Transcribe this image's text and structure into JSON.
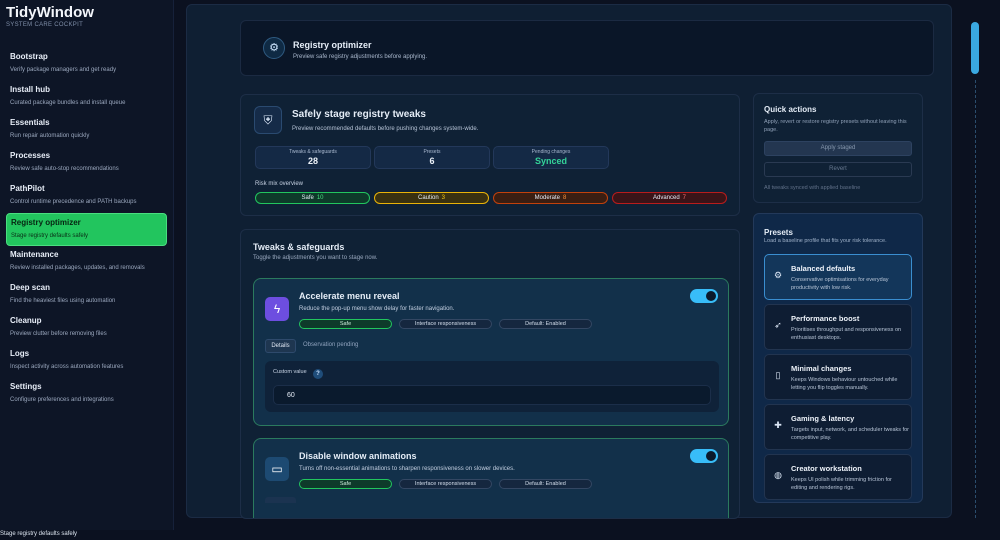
{
  "app": {
    "title": "TidyWindow",
    "subtitle": "SYSTEM CARE COCKPIT"
  },
  "sidebar": {
    "items": [
      {
        "label": "Bootstrap",
        "desc": "Verify package managers and get ready"
      },
      {
        "label": "Install hub",
        "desc": "Curated package bundles and install queue"
      },
      {
        "label": "Essentials",
        "desc": "Run repair automation quickly"
      },
      {
        "label": "Processes",
        "desc": "Review safe auto-stop recommendations"
      },
      {
        "label": "PathPilot",
        "desc": "Control runtime precedence and PATH backups"
      },
      {
        "label": "Registry optimizer",
        "desc": "Stage registry defaults safely",
        "active": true
      },
      {
        "label": "Maintenance",
        "desc": "Review installed packages, updates, and removals"
      },
      {
        "label": "Deep scan",
        "desc": "Find the heaviest files using automation"
      },
      {
        "label": "Cleanup",
        "desc": "Preview clutter before removing files"
      },
      {
        "label": "Logs",
        "desc": "Inspect activity across automation features"
      },
      {
        "label": "Settings",
        "desc": "Configure preferences and integrations"
      }
    ]
  },
  "header": {
    "title": "Registry optimizer",
    "subtitle": "Preview safe registry adjustments before applying.",
    "icon": "registry-icon"
  },
  "stage": {
    "title": "Safely stage registry tweaks",
    "subtitle": "Preview recommended defaults before pushing changes system-wide.",
    "stats": [
      {
        "label": "Tweaks & safeguards",
        "value": "28"
      },
      {
        "label": "Presets",
        "value": "6"
      },
      {
        "label": "Pending changes",
        "value": "Synced"
      }
    ],
    "risk_label": "Risk mix overview",
    "risk": [
      {
        "name": "Safe",
        "count": "10"
      },
      {
        "name": "Caution",
        "count": "3"
      },
      {
        "name": "Moderate",
        "count": "8"
      },
      {
        "name": "Advanced",
        "count": "7"
      }
    ]
  },
  "tweaks": {
    "title": "Tweaks & safeguards",
    "subtitle": "Toggle the adjustments you want to stage now.",
    "cards": [
      {
        "title": "Accelerate menu reveal",
        "desc": "Reduce the pop-up menu show delay for faster navigation.",
        "tags": [
          "Safe",
          "Interface responsiveness",
          "Default: Enabled"
        ],
        "details_label": "Details",
        "observation": "Observation pending",
        "custom_label": "Custom value",
        "custom_value": "60",
        "enabled": true
      },
      {
        "title": "Disable window animations",
        "desc": "Turns off non-essential animations to sharpen responsiveness on slower devices.",
        "tags": [
          "Safe",
          "Interface responsiveness",
          "Default: Enabled"
        ],
        "enabled": true
      }
    ]
  },
  "quick_actions": {
    "title": "Quick actions",
    "subtitle": "Apply, revert or restore registry presets without leaving this page.",
    "apply_label": "Apply staged",
    "revert_label": "Revert",
    "note": "All tweaks synced with applied baseline"
  },
  "presets": {
    "title": "Presets",
    "subtitle": "Load a baseline profile that fits your risk tolerance.",
    "items": [
      {
        "title": "Balanced defaults",
        "desc": "Conservative optimisations for everyday productivity with low risk.",
        "icon": "gear-icon",
        "selected": true
      },
      {
        "title": "Performance boost",
        "desc": "Prioritises throughput and responsiveness on enthusiast desktops.",
        "icon": "rocket-icon"
      },
      {
        "title": "Minimal changes",
        "desc": "Keeps Windows behaviour untouched while letting you flip toggles manually.",
        "icon": "phone-icon"
      },
      {
        "title": "Gaming & latency",
        "desc": "Targets input, network, and scheduler tweaks for competitive play.",
        "icon": "gamepad-icon"
      },
      {
        "title": "Creator workstation",
        "desc": "Keeps UI polish while trimming friction for editing and rendering rigs.",
        "icon": "palette-icon"
      }
    ]
  },
  "status_bar": {
    "text": "Stage registry defaults safely"
  },
  "colors": {
    "accent": "#38bdf8",
    "active_nav": "#22c55e",
    "synced": "#34d399"
  }
}
